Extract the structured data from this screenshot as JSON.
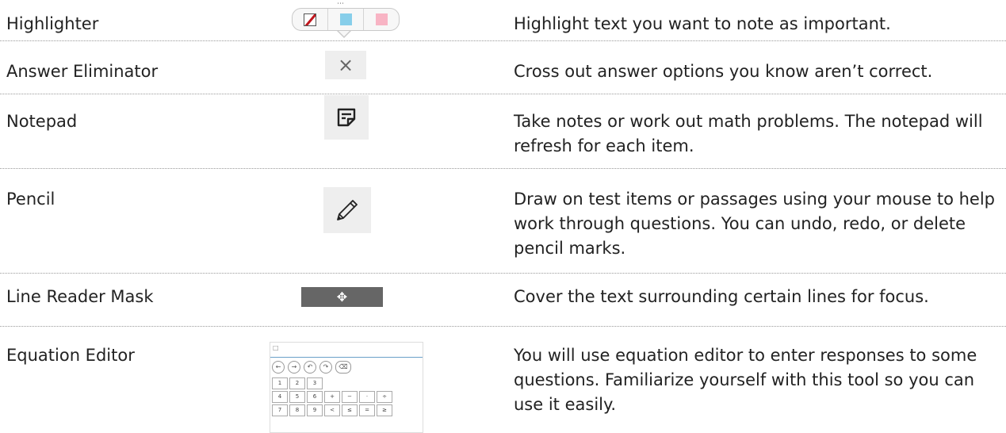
{
  "tools": [
    {
      "id": "highlighter",
      "name": "Highlighter",
      "description": "Highlight text you want to note as important."
    },
    {
      "id": "eliminator",
      "name": "Answer Eliminator",
      "description": "Cross out answer options you know aren’t correct."
    },
    {
      "id": "notepad",
      "name": "Notepad",
      "description": "Take notes or work out math problems. The notepad will refresh for each item."
    },
    {
      "id": "pencil",
      "name": "Pencil",
      "description": "Draw on test items or passages using your mouse to help work through questions. You can undo, redo, or delete pencil marks."
    },
    {
      "id": "line-reader",
      "name": "Line Reader Mask",
      "description": "Cover the text surrounding certain lines for focus."
    },
    {
      "id": "equation-editor",
      "name": "Equation Editor",
      "description": "You will use equation editor to enter responses to some questions. Familiarize yourself with this tool so you can use it easily."
    }
  ],
  "highlighter": {
    "icon_names": [
      "pen-clear-icon",
      "blue-swatch-icon",
      "pink-swatch-icon"
    ],
    "colors": {
      "blue": "#87ceea",
      "pink": "#f8b4c4",
      "pen": "#c0161d"
    }
  },
  "eliminator_symbol": "×",
  "line_reader_symbol": "✥",
  "equation_editor": {
    "nav_buttons": [
      "←",
      "→",
      "↶",
      "↷",
      "⌫"
    ],
    "keys": [
      [
        "1",
        "2",
        "3"
      ],
      [
        "4",
        "5",
        "6",
        "+",
        "−",
        "·",
        "÷"
      ],
      [
        "7",
        "8",
        "9",
        "<",
        "≤",
        "=",
        "≥"
      ]
    ]
  }
}
